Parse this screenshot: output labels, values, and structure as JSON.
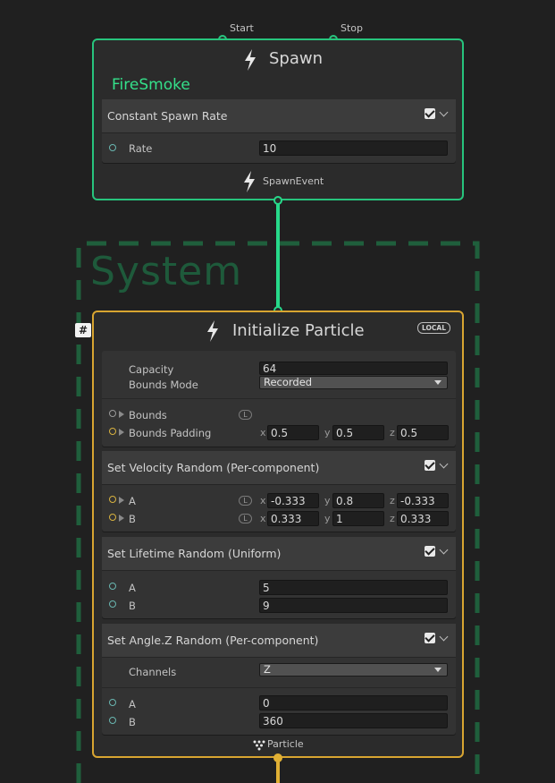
{
  "colors": {
    "background": "#202020",
    "spawn_border": "#27c47d",
    "init_border": "#d8a531",
    "system_border": "#1f5f3c",
    "system_title": "#1e5a3b",
    "flow_green": "#27d98a",
    "flow_yellow": "#e0b034",
    "system_name": "#34e08a"
  },
  "spawn": {
    "start_label": "Start",
    "stop_label": "Stop",
    "title": "Spawn",
    "system_name": "FireSmoke",
    "block": {
      "title": "Constant Spawn Rate",
      "rate_label": "Rate",
      "rate_value": "10"
    },
    "output_label": "SpawnEvent"
  },
  "system": {
    "title": "System",
    "badge": "#"
  },
  "init": {
    "title": "Initialize Particle",
    "space_badge": "LOCAL",
    "capacity_label": "Capacity",
    "capacity_value": "64",
    "bounds_mode_label": "Bounds Mode",
    "bounds_mode_value": "Recorded",
    "bounds_label": "Bounds",
    "bounds_padding_label": "Bounds Padding",
    "bounds_padding": {
      "x": "0.5",
      "y": "0.5",
      "z": "0.5"
    },
    "lock_glyph": "L",
    "axis": {
      "x": "x",
      "y": "y",
      "z": "z"
    },
    "velocity": {
      "title": "Set Velocity Random (Per-component)",
      "a_label": "A",
      "b_label": "B",
      "a": {
        "x": "-0.333",
        "y": "0.8",
        "z": "-0.333"
      },
      "b": {
        "x": "0.333",
        "y": "1",
        "z": "0.333"
      }
    },
    "lifetime": {
      "title": "Set Lifetime Random (Uniform)",
      "a_label": "A",
      "b_label": "B",
      "a_value": "5",
      "b_value": "9"
    },
    "angle": {
      "title": "Set Angle.Z Random (Per-component)",
      "channels_label": "Channels",
      "channels_value": "Z",
      "a_label": "A",
      "b_label": "B",
      "a_value": "0",
      "b_value": "360"
    },
    "output_label": "Particle"
  }
}
